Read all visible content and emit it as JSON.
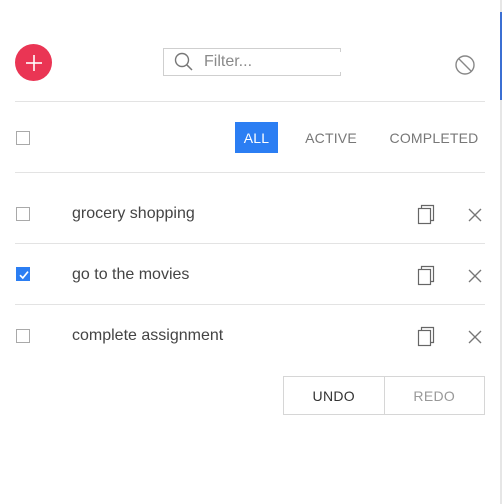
{
  "header": {
    "add_button_icon": "plus-icon",
    "search": {
      "placeholder": "Filter...",
      "value": ""
    },
    "clear_icon": "block-icon"
  },
  "filters": [
    {
      "label": "ALL",
      "active": true
    },
    {
      "label": "ACTIVE",
      "active": false
    },
    {
      "label": "COMPLETED",
      "active": false
    }
  ],
  "todos": [
    {
      "text": "grocery shopping",
      "completed": false
    },
    {
      "text": "go to the movies",
      "completed": true
    },
    {
      "text": "complete assignment",
      "completed": false
    }
  ],
  "history": {
    "undo_label": "UNDO",
    "redo_label": "REDO"
  },
  "colors": {
    "add_button": "#ea3554",
    "accent": "#2b7ef3"
  }
}
